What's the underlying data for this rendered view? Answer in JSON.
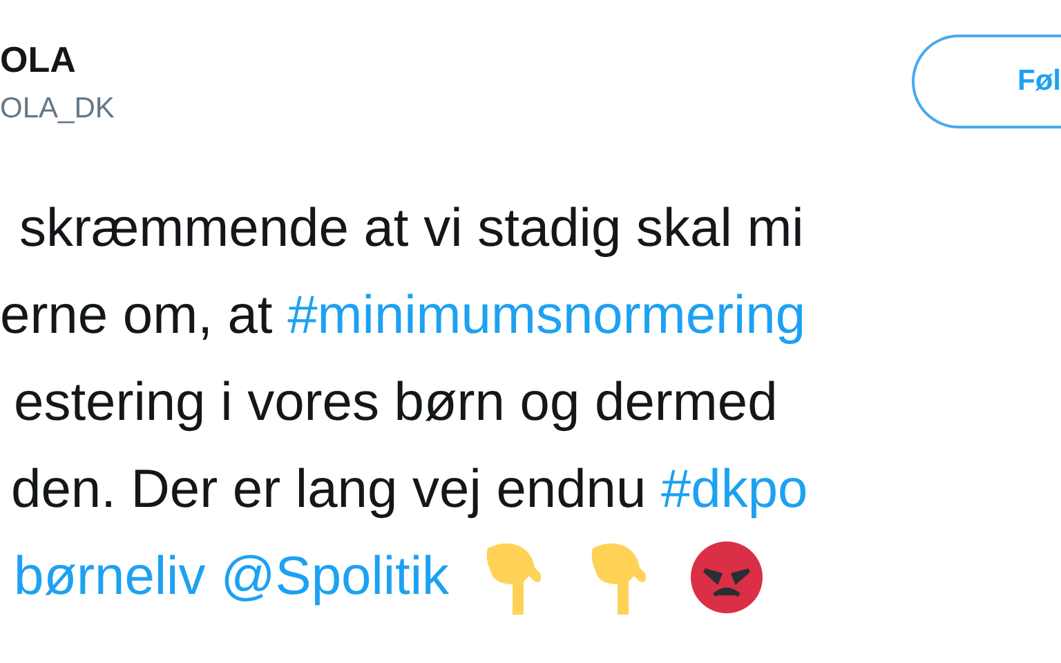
{
  "author": {
    "name": "OLA",
    "handle": "OLA_DK"
  },
  "follow_button": {
    "label": "Føl"
  },
  "tweet_lines": [
    {
      "segments": [
        {
          "kind": "text",
          "text": "skræmmende at vi stadig skal mi"
        }
      ]
    },
    {
      "segments": [
        {
          "kind": "text",
          "text": "erne om, at "
        },
        {
          "kind": "link",
          "text": "#minimumsnormering"
        }
      ]
    },
    {
      "segments": [
        {
          "kind": "text",
          "text": "estering i vores børn og dermed"
        }
      ]
    },
    {
      "segments": [
        {
          "kind": "text",
          "text": "den. Der er lang vej endnu "
        },
        {
          "kind": "link",
          "text": "#dkpo"
        }
      ]
    },
    {
      "segments": [
        {
          "kind": "link",
          "text": "børneliv"
        },
        {
          "kind": "link",
          "text": "@Spolitik"
        },
        {
          "kind": "point-down"
        },
        {
          "kind": "point-down"
        },
        {
          "kind": "angry"
        }
      ]
    }
  ]
}
